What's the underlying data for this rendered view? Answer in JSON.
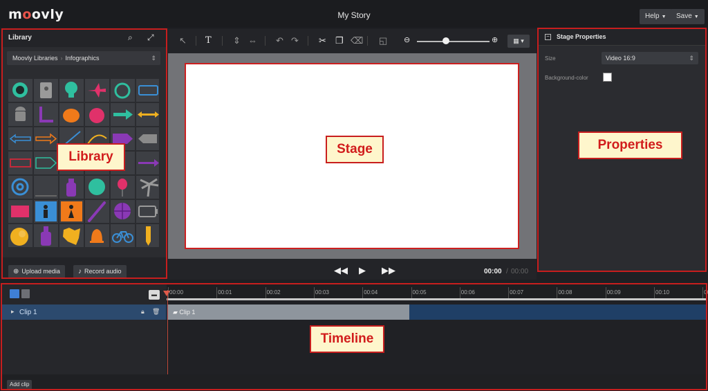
{
  "app": {
    "logo": "moovly",
    "title": "My Story",
    "help_label": "Help",
    "save_label": "Save"
  },
  "library": {
    "title": "Library",
    "breadcrumb_root": "Moovly Libraries",
    "breadcrumb_current": "Infographics",
    "upload_label": "Upload media",
    "record_label": "Record audio",
    "icons": [
      "clock-arrows",
      "contacts-book",
      "lightbulb",
      "airplane",
      "alarm-clock",
      "digital-clock",
      "android-robot",
      "l-bracket",
      "pumpkin",
      "apple",
      "arrow-right",
      "double-arrow",
      "outline-arrow",
      "outline-arrow-orange",
      "line-arrow",
      "curved-arrow",
      "pentagon-arrow",
      "grey-arrow",
      "red-rectangle-arrow",
      "teal-arrow",
      "blank",
      "blank",
      "blank",
      "purple-arrow",
      "at-sign",
      "line",
      "bottle",
      "ball",
      "balloon",
      "palm-tree",
      "red-rectangle",
      "male-sign",
      "female-sign",
      "baseball-bat",
      "basketball",
      "battery",
      "billiard-ball",
      "bottle-purple",
      "map-shape",
      "bell",
      "bicycle",
      "pencil"
    ]
  },
  "toolbar": {
    "text_tool": "T",
    "cut": "✂",
    "zoom_out": "🔍",
    "zoom_in": "🔍",
    "zoom_level": 0.4
  },
  "stage": {
    "aspect": "Video 16:9"
  },
  "player": {
    "current_time": "00:00",
    "separator": "/",
    "total_time": "00:00"
  },
  "properties": {
    "title": "Stage Properties",
    "size_label": "Size",
    "size_value": "Video 16:9",
    "bg_label": "Background-color",
    "bg_color": "#ffffff"
  },
  "timeline": {
    "ticks": [
      "00:00",
      "00:01",
      "00:02",
      "00:03",
      "00:04",
      "00:05",
      "00:06",
      "00:07",
      "00:08",
      "00:09",
      "00:10",
      "00"
    ],
    "clip_row_label": "Clip 1",
    "clip_block_label": "Clip 1",
    "add_clip_label": "Add clip"
  },
  "annotations": {
    "library": "Library",
    "stage": "Stage",
    "properties": "Properties",
    "timeline": "Timeline"
  },
  "colors": {
    "accent_red": "#c81e1e",
    "callout_bg": "#fef6cc",
    "clip_blue": "#1f3f66",
    "toggle_blue": "#3f7fd6"
  }
}
